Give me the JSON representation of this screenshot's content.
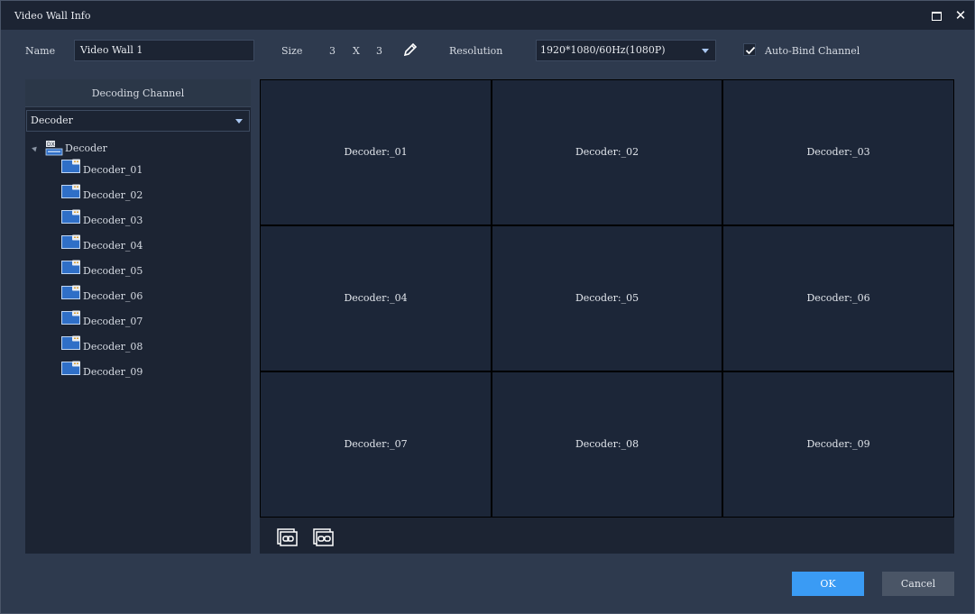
{
  "window": {
    "title": "Video Wall  Info"
  },
  "form": {
    "name_label": "Name",
    "name_value": "Video Wall 1",
    "size_label": "Size",
    "size_rows": "3",
    "size_sep": "X",
    "size_cols": "3",
    "resolution_label": "Resolution",
    "resolution_value": "1920*1080/60Hz(1080P)",
    "auto_bind_label": "Auto-Bind Channel",
    "auto_bind_checked": true
  },
  "left_panel": {
    "header": "Decoding Channel",
    "filter_value": "Decoder",
    "tree": {
      "root_label": "Decoder",
      "items": [
        "Decoder_01",
        "Decoder_02",
        "Decoder_03",
        "Decoder_04",
        "Decoder_05",
        "Decoder_06",
        "Decoder_07",
        "Decoder_08",
        "Decoder_09"
      ]
    }
  },
  "wall": {
    "cells": [
      "Decoder:_01",
      "Decoder:_02",
      "Decoder:_03",
      "Decoder:_04",
      "Decoder:_05",
      "Decoder:_06",
      "Decoder:_07",
      "Decoder:_08",
      "Decoder:_09"
    ]
  },
  "buttons": {
    "ok": "OK",
    "cancel": "Cancel"
  },
  "colors": {
    "accent": "#3a9bf4",
    "panel": "#1c2433",
    "dialog": "#2e3a4e"
  },
  "icons": {
    "edit": "pencil-icon",
    "bind": "link-icon",
    "unbind": "unlink-icon",
    "maximize": "maximize-icon",
    "close": "close-icon"
  }
}
